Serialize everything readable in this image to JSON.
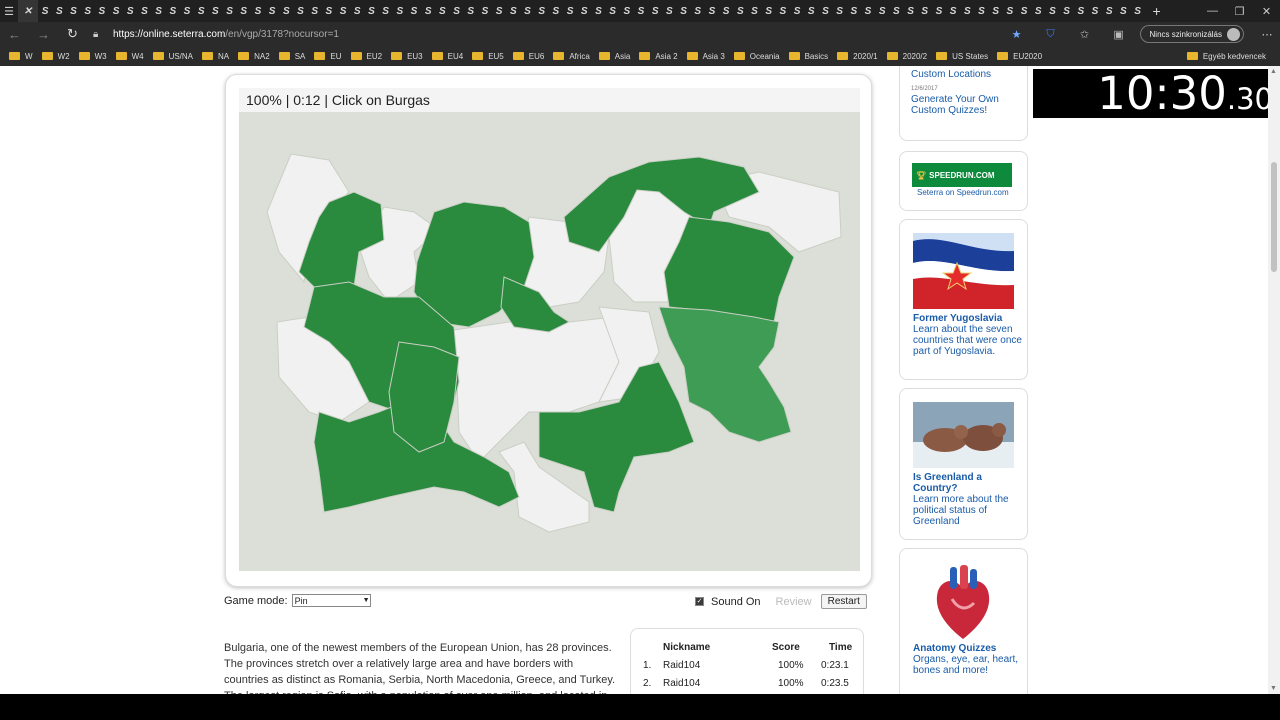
{
  "browser": {
    "tab_glyph": "S",
    "tab_count": 78,
    "tab_close": "✕",
    "new_tab": "+",
    "url_host": "https://online.seterra.com",
    "url_path": "/en/vgp/3178?nocursor=1",
    "sync_label": "Nincs szinkronizálás",
    "bookmarks": [
      "W",
      "W2",
      "W3",
      "W4",
      "US/NA",
      "NA",
      "NA2",
      "SA",
      "EU",
      "EU2",
      "EU3",
      "EU4",
      "EU5",
      "EU6",
      "Africa",
      "Asia",
      "Asia 2",
      "Asia 3",
      "Oceania",
      "Basics",
      "2020/1",
      "2020/2",
      "US States",
      "EU2020"
    ],
    "bookmarks_other": "Egyéb kedvencek"
  },
  "game": {
    "status_line": "100% | 0:12 | Click on Burgas",
    "mode_label": "Game mode:",
    "mode_value": "Pin",
    "sound_label": "Sound On",
    "review_label": "Review",
    "restart_label": "Restart",
    "colors": {
      "done": "#2a8a3e",
      "hover": "#3f9c55",
      "todo": "#f1f1f1",
      "border": "#c9cfc4",
      "bg": "#dcdfd8"
    }
  },
  "description": "Bulgaria, one of the newest members of the European Union, has 28 provinces. The provinces stretch over a relatively large area and have borders with countries as distinct as Romania, Serbia, North Macedonia, Greece, and Turkey. The largest region is Sofia, with a population of over one million, and located in",
  "leaderboard": {
    "headers": {
      "nickname": "Nickname",
      "score": "Score",
      "time": "Time"
    },
    "rows": [
      {
        "rank": "1.",
        "nickname": "Raid104",
        "score": "100%",
        "time": "0:23.1"
      },
      {
        "rank": "2.",
        "nickname": "Raid104",
        "score": "100%",
        "time": "0:23.5"
      }
    ]
  },
  "sidebar": {
    "top_link": "Custom Locations",
    "date": "12/6/2017",
    "custom_quiz": "Generate Your Own Custom Quizzes!",
    "speedrun_logo": "SPEEDRUN.COM",
    "speedrun_caption": "Seterra on Speedrun.com",
    "yugo_title": "Former Yugoslavia",
    "yugo_body": "Learn about the seven countries that were once part of Yugoslavia.",
    "greenland_title": "Is Greenland a Country?",
    "greenland_body": "Learn more about the political status of Greenland",
    "anatomy_title": "Anatomy Quizzes",
    "anatomy_body": "Organs, eye, ear, heart, bones and more!"
  },
  "timer": {
    "main": "10:30",
    "fraction": ".30"
  }
}
